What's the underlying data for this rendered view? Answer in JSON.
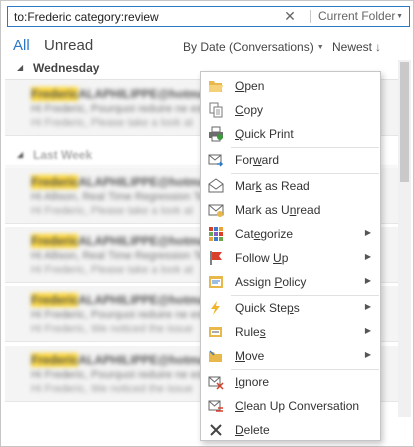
{
  "search": {
    "query": "to:Frederic category:review",
    "clear_glyph": "✕",
    "scope": "Current Folder",
    "scope_caret": "▼"
  },
  "filters": {
    "all": "All",
    "unread": "Unread",
    "sort_by": "By Date (Conversations)",
    "sort_by_caret": "▼",
    "sort_order": "Newest",
    "sort_order_arrow": "↓"
  },
  "groups": [
    {
      "label": "Wednesday",
      "collapse_glyph": "◢"
    },
    {
      "label": "Last Week",
      "collapse_glyph": "◢"
    }
  ],
  "mails": [
    {
      "sender": "Frederic",
      "sender_rest": "ALAPHILIPPE@hotmail.com",
      "line2": "Hi Frederic, Pourquoi reduire ne est pas",
      "line3": "Hi Frederic, Please take a look at"
    },
    {
      "sender": "Frederic",
      "sender_rest": "ALAPHILIPPE@hotmail.com",
      "line2": "Hi Allison, Real Time Regression Testing",
      "line3": "Hi Frederic, Please take a look at"
    },
    {
      "sender": "Frederic",
      "sender_rest": "ALAPHILIPPE@hotmail.com",
      "line2": "Hi Allison, Real Time Regression Testing",
      "line3": "Hi Frederic, Please take a look at"
    },
    {
      "sender": "Frederic",
      "sender_rest": "ALAPHILIPPE@hotmail.com",
      "line2": "Hi Frederic, Pourquoi reduire ne est pas",
      "line3": "Hi Frederic, We noticed the issue"
    },
    {
      "sender": "Frederic",
      "sender_rest": "ALAPHILIPPE@hotmail.com",
      "line2": "Hi Frederic, Pourquoi reduire ne est pas",
      "line3": "Hi Frederic, We noticed the issue"
    }
  ],
  "menu": {
    "items": [
      {
        "name": "open",
        "before": "",
        "key": "O",
        "after": "pen",
        "icon": "folder-open-icon",
        "submenu": false
      },
      {
        "name": "copy",
        "before": "",
        "key": "C",
        "after": "opy",
        "icon": "copy-icon",
        "submenu": false
      },
      {
        "name": "quick-print",
        "before": "",
        "key": "Q",
        "after": "uick Print",
        "icon": "printer-icon",
        "submenu": false
      },
      {
        "name": "forward",
        "before": "For",
        "key": "w",
        "after": "ard",
        "icon": "forward-icon",
        "submenu": false
      },
      {
        "name": "mark-as-read",
        "before": "Mar",
        "key": "k",
        "after": " as Read",
        "icon": "envelope-open-icon",
        "submenu": false
      },
      {
        "name": "mark-as-unread",
        "before": "Mark as U",
        "key": "n",
        "after": "read",
        "icon": "envelope-closed-icon",
        "submenu": false
      },
      {
        "name": "categorize",
        "before": "Cat",
        "key": "e",
        "after": "gorize",
        "icon": "category-grid-icon",
        "submenu": true
      },
      {
        "name": "follow-up",
        "before": "Follow ",
        "key": "U",
        "after": "p",
        "icon": "flag-icon",
        "submenu": true
      },
      {
        "name": "assign-policy",
        "before": "Assign ",
        "key": "P",
        "after": "olicy",
        "icon": "policy-icon",
        "submenu": true
      },
      {
        "name": "quick-steps",
        "before": "Quick Ste",
        "key": "p",
        "after": "s",
        "icon": "lightning-icon",
        "submenu": true
      },
      {
        "name": "rules",
        "before": "Rule",
        "key": "s",
        "after": "",
        "icon": "rules-icon",
        "submenu": true
      },
      {
        "name": "move",
        "before": "",
        "key": "M",
        "after": "ove",
        "icon": "move-folder-icon",
        "submenu": true
      },
      {
        "name": "ignore",
        "before": "",
        "key": "I",
        "after": "gnore",
        "icon": "ignore-icon",
        "submenu": false
      },
      {
        "name": "clean-up-conversation",
        "before": "",
        "key": "C",
        "after": "lean Up Conversation",
        "icon": "cleanup-icon",
        "submenu": false
      },
      {
        "name": "delete",
        "before": "",
        "key": "D",
        "after": "elete",
        "icon": "delete-x-icon",
        "submenu": false
      }
    ],
    "submenu_glyph": "▶"
  },
  "colors": {
    "accent": "#2b78c5",
    "highlight": "#ffd93b"
  }
}
